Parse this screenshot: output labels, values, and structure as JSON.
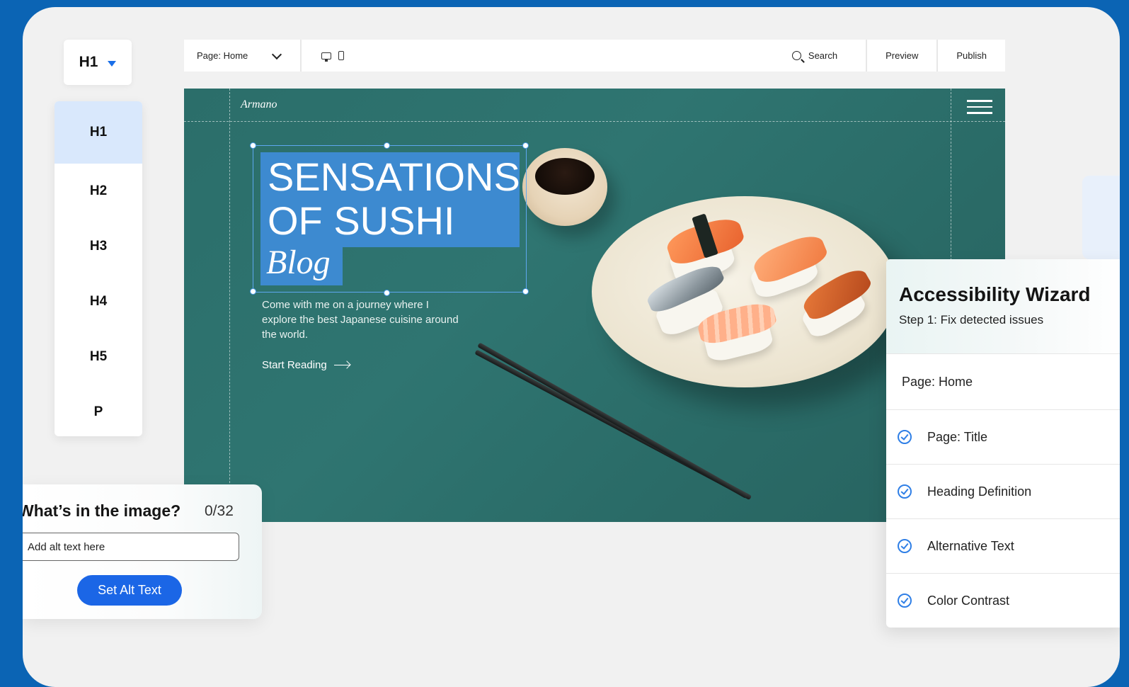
{
  "heading_selector": {
    "current": "H1",
    "options": [
      "H1",
      "H2",
      "H3",
      "H4",
      "H5",
      "P"
    ]
  },
  "toolbar": {
    "page_select": "Page: Home",
    "search_label": "Search",
    "preview_label": "Preview",
    "publish_label": "Publish"
  },
  "site": {
    "logo": "Armano",
    "hero_line1": "SENSATIONS",
    "hero_line2": "OF SUSHI",
    "hero_line3": "Blog",
    "description": "Come with me on a journey where I explore the best Japanese cuisine around the world.",
    "cta": "Start Reading"
  },
  "wizard": {
    "title": "Accessibility Wizard",
    "subtitle": "Step 1: Fix detected issues",
    "page": "Page: Home",
    "items": [
      "Page: Title",
      "Heading Definition",
      "Alternative Text",
      "Color Contrast"
    ]
  },
  "alt_panel": {
    "question": "What’s in the image?",
    "count": "0/32",
    "placeholder": "Add alt text here",
    "button": "Set Alt Text"
  },
  "colors": {
    "frame": "#0b64b4",
    "accent_blue": "#1b66e6",
    "hero_teal": "#2f7571",
    "highlight": "#3d8ad0"
  }
}
